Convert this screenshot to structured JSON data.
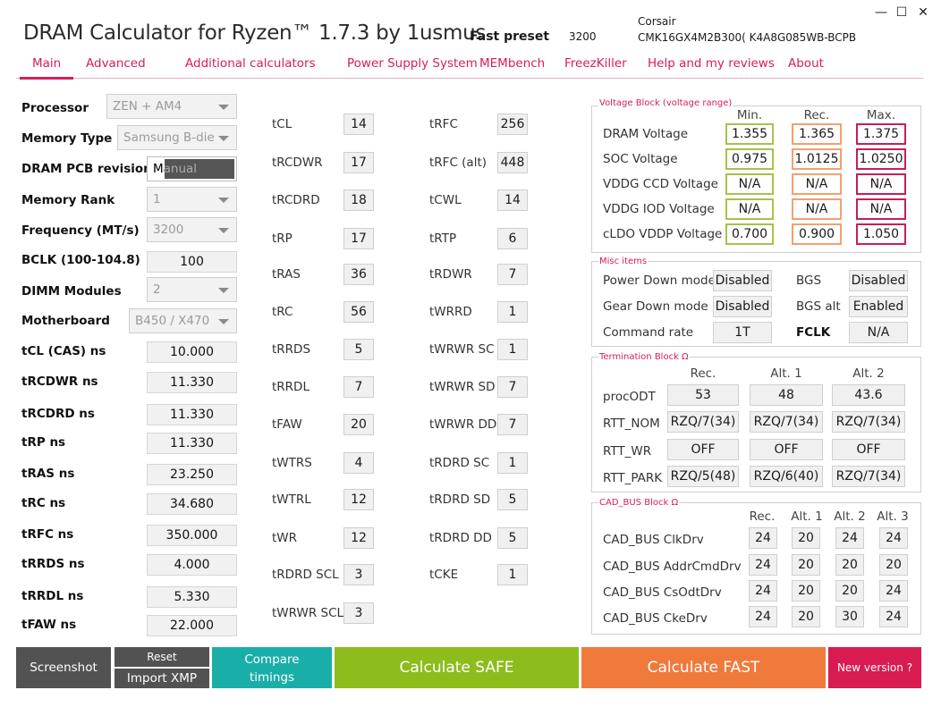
{
  "app": {
    "title": "DRAM Calculator for Ryzen™ 1.7.3 by 1usmus",
    "preset_label": "Fast preset",
    "preset_value": "3200",
    "memory_vendor": "Corsair",
    "memory_part": "CMK16GX4M2B300( K4A8G085WB-BCPB"
  },
  "window_controls": [
    "—",
    "☐",
    "✕"
  ],
  "nav": [
    "Main",
    "Advanced",
    "Additional calculators",
    "Power Supply System",
    "MEMbench",
    "FreezKiller",
    "Help and my reviews",
    "About"
  ],
  "settings": {
    "processor": {
      "label": "Processor",
      "value": "ZEN + AM4"
    },
    "memory_type": {
      "label": "Memory Type",
      "value": "Samsung B-die"
    },
    "pcb": {
      "label": "DRAM PCB revision",
      "value": "Manual"
    },
    "rank": {
      "label": "Memory Rank",
      "value": "1"
    },
    "freq": {
      "label": "Frequency (MT/s)",
      "value": "3200"
    },
    "bclk": {
      "label": "BCLK (100-104.8)",
      "value": "100"
    },
    "dimm": {
      "label": "DIMM Modules",
      "value": "2"
    },
    "mobo": {
      "label": "Motherboard",
      "value": "B450 / X470"
    }
  },
  "ns": [
    {
      "label": "tCL (CAS) ns",
      "value": "10.000"
    },
    {
      "label": "tRCDWR ns",
      "value": "11.330"
    },
    {
      "label": "tRCDRD ns",
      "value": "11.330"
    },
    {
      "label": "tRP ns",
      "value": "11.330"
    },
    {
      "label": "tRAS ns",
      "value": "23.250"
    },
    {
      "label": "tRC ns",
      "value": "34.680"
    },
    {
      "label": "tRFC ns",
      "value": "350.000"
    },
    {
      "label": "tRRDS ns",
      "value": "4.000"
    },
    {
      "label": "tRRDL ns",
      "value": "5.330"
    },
    {
      "label": "tFAW ns",
      "value": "22.000"
    }
  ],
  "timings_a": [
    {
      "label": "tCL",
      "value": "14"
    },
    {
      "label": "tRCDWR",
      "value": "17"
    },
    {
      "label": "tRCDRD",
      "value": "18"
    },
    {
      "label": "tRP",
      "value": "17"
    },
    {
      "label": "tRAS",
      "value": "36"
    },
    {
      "label": "tRC",
      "value": "56"
    },
    {
      "label": "tRRDS",
      "value": "5"
    },
    {
      "label": "tRRDL",
      "value": "7"
    },
    {
      "label": "tFAW",
      "value": "20"
    },
    {
      "label": "tWTRS",
      "value": "4"
    },
    {
      "label": "tWTRL",
      "value": "12"
    },
    {
      "label": "tWR",
      "value": "12"
    },
    {
      "label": "tRDRD SCL",
      "value": "3"
    },
    {
      "label": "tWRWR SCL",
      "value": "3"
    }
  ],
  "timings_b": [
    {
      "label": "tRFC",
      "value": "256"
    },
    {
      "label": "tRFC (alt)",
      "value": "448"
    },
    {
      "label": "tCWL",
      "value": "14"
    },
    {
      "label": "tRTP",
      "value": "6"
    },
    {
      "label": "tRDWR",
      "value": "7"
    },
    {
      "label": "tWRRD",
      "value": "1"
    },
    {
      "label": "tWRWR SC",
      "value": "1"
    },
    {
      "label": "tWRWR SD",
      "value": "7"
    },
    {
      "label": "tWRWR DD",
      "value": "7"
    },
    {
      "label": "tRDRD SC",
      "value": "1"
    },
    {
      "label": "tRDRD SD",
      "value": "5"
    },
    {
      "label": "tRDRD DD",
      "value": "5"
    },
    {
      "label": "tCKE",
      "value": "1"
    }
  ],
  "voltage": {
    "title": "Voltage Block (voltage range)",
    "headers": [
      "Min.",
      "Rec.",
      "Max."
    ],
    "rows": [
      {
        "label": "DRAM Voltage",
        "min": "1.355",
        "rec": "1.365",
        "max": "1.375"
      },
      {
        "label": "SOC Voltage",
        "min": "0.975",
        "rec": "1.0125",
        "max": "1.0250"
      },
      {
        "label": "VDDG  CCD Voltage",
        "min": "N/A",
        "rec": "N/A",
        "max": "N/A"
      },
      {
        "label": "VDDG  IOD Voltage",
        "min": "N/A",
        "rec": "N/A",
        "max": "N/A"
      },
      {
        "label": "cLDO VDDP Voltage",
        "min": "0.700",
        "rec": "0.900",
        "max": "1.050"
      }
    ]
  },
  "misc": {
    "title": "Misc items",
    "power_down_label": "Power Down mode",
    "power_down": "Disabled",
    "bgs_label": "BGS",
    "bgs": "Disabled",
    "gear_down_label": "Gear Down mode",
    "gear_down": "Disabled",
    "bgs_alt_label": "BGS alt",
    "bgs_alt": "Enabled",
    "command_rate_label": "Command rate",
    "command_rate": "1T",
    "fclk_label": "FCLK",
    "fclk": "N/A"
  },
  "termination": {
    "title": "Termination Block Ω",
    "headers": [
      "Rec.",
      "Alt. 1",
      "Alt. 2"
    ],
    "rows": [
      {
        "label": "procODT",
        "values": [
          "53",
          "48",
          "43.6"
        ]
      },
      {
        "label": "RTT_NOM",
        "values": [
          "RZQ/7(34)",
          "RZQ/7(34)",
          "RZQ/7(34)"
        ]
      },
      {
        "label": "RTT_WR",
        "values": [
          "OFF",
          "OFF",
          "OFF"
        ]
      },
      {
        "label": "RTT_PARK",
        "values": [
          "RZQ/5(48)",
          "RZQ/6(40)",
          "RZQ/7(34)"
        ]
      }
    ]
  },
  "cadbus": {
    "title": "CAD_BUS Block Ω",
    "headers": [
      "Rec.",
      "Alt. 1",
      "Alt. 2",
      "Alt. 3"
    ],
    "rows": [
      {
        "label": "CAD_BUS ClkDrv",
        "values": [
          "24",
          "20",
          "24",
          "24"
        ]
      },
      {
        "label": "CAD_BUS AddrCmdDrv",
        "values": [
          "24",
          "20",
          "20",
          "20"
        ]
      },
      {
        "label": "CAD_BUS CsOdtDrv",
        "values": [
          "24",
          "20",
          "20",
          "24"
        ]
      },
      {
        "label": "CAD_BUS CkeDrv",
        "values": [
          "24",
          "20",
          "30",
          "24"
        ]
      }
    ]
  },
  "buttons": {
    "screenshot": "Screenshot",
    "reset": "Reset",
    "import_xmp": "Import XMP",
    "compare": "Compare timings (ON/OFF)",
    "safe": "Calculate SAFE",
    "fast": "Calculate FAST",
    "new_version": "New version ?"
  },
  "colors": {
    "accent": "#d81b60",
    "safe": "#8cbd1d",
    "fast": "#f07a3c",
    "compare": "#1aaea9",
    "dark": "#525252",
    "new_version": "#d81b50"
  }
}
